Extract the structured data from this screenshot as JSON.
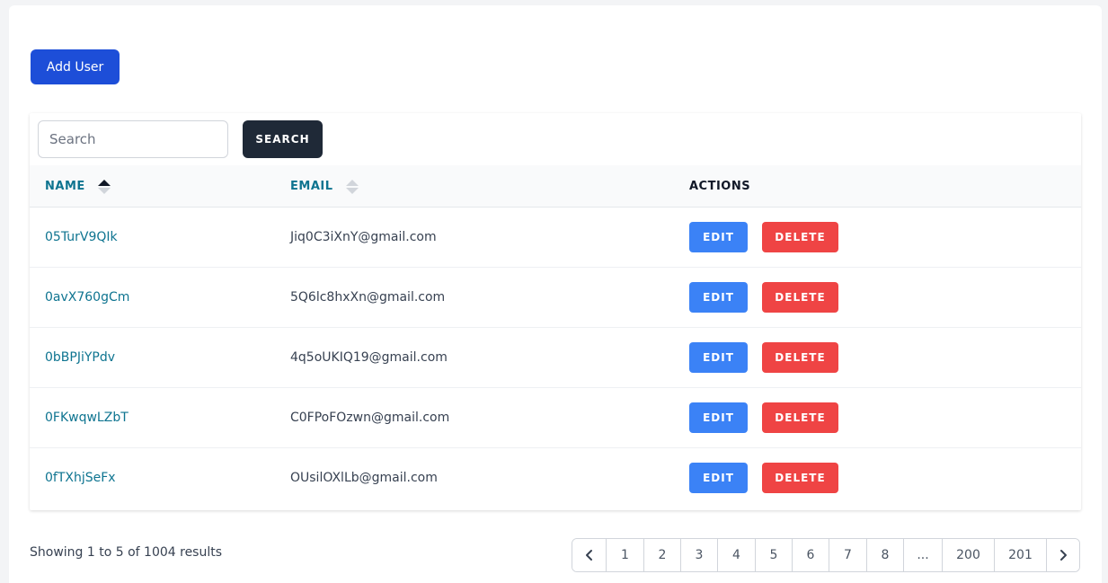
{
  "toolbar": {
    "add_user_label": "Add User"
  },
  "search": {
    "placeholder": "Search",
    "value": "",
    "button_label": "SEARCH"
  },
  "table": {
    "columns": {
      "name": "NAME",
      "email": "EMAIL",
      "actions": "ACTIONS"
    },
    "sort": {
      "column": "name",
      "direction": "ascending"
    },
    "rows": [
      {
        "name": "05TurV9QIk",
        "email": "Jiq0C3iXnY@gmail.com"
      },
      {
        "name": "0avX760gCm",
        "email": "5Q6lc8hxXn@gmail.com"
      },
      {
        "name": "0bBPJiYPdv",
        "email": "4q5oUKIQ19@gmail.com"
      },
      {
        "name": "0FKwqwLZbT",
        "email": "C0FPoFOzwn@gmail.com"
      },
      {
        "name": "0fTXhjSeFx",
        "email": "OUsilOXlLb@gmail.com"
      }
    ],
    "edit_label": "EDIT",
    "delete_label": "DELETE"
  },
  "footer": {
    "summary": "Showing 1 to 5 of 1004 results",
    "pages": [
      "1",
      "2",
      "3",
      "4",
      "5",
      "6",
      "7",
      "8",
      "...",
      "200",
      "201"
    ]
  },
  "colors": {
    "primary": "#1d4ed8",
    "edit": "#3b82f6",
    "delete": "#ef4444",
    "link": "#0e7490",
    "dark": "#1f2937"
  },
  "icons": [
    "sort-asc-icon",
    "sort-icon",
    "chevron-left-icon",
    "chevron-right-icon"
  ]
}
